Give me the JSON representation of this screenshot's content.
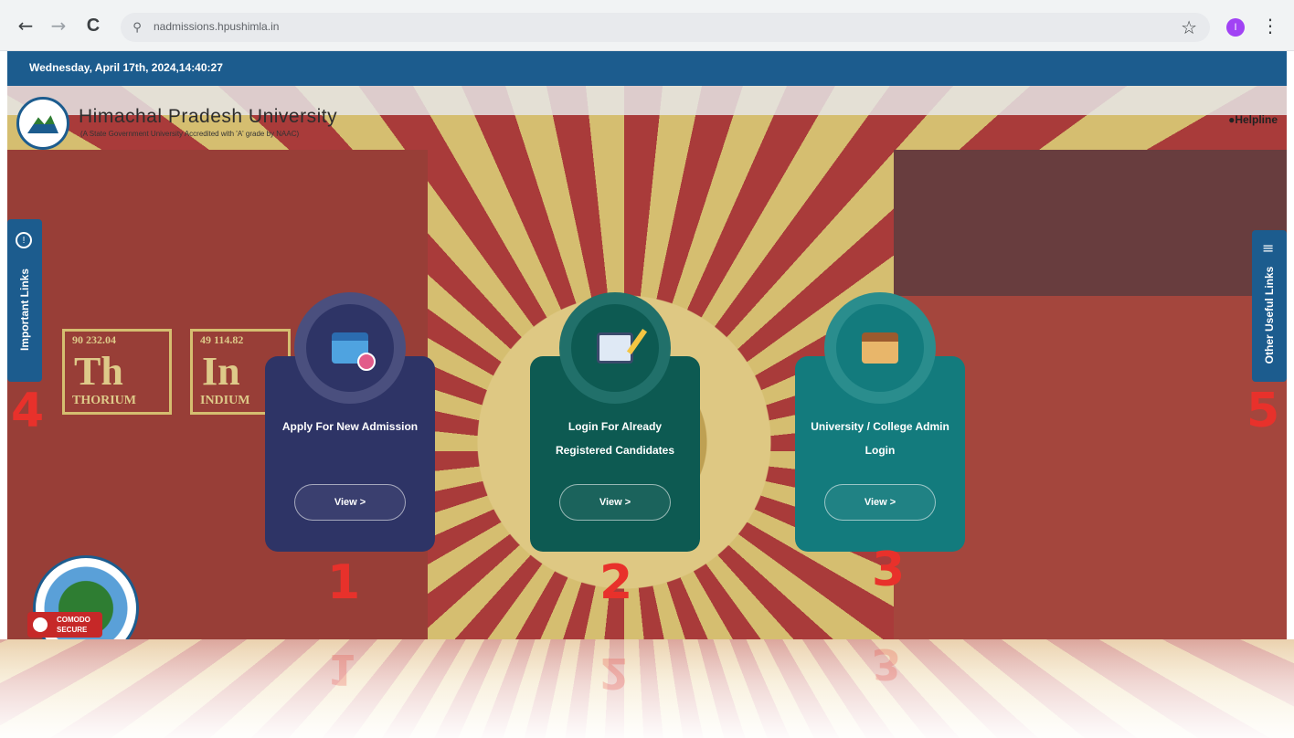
{
  "browser": {
    "back_icon": "←",
    "forward_icon": "→",
    "reload_icon": "C",
    "site_info_icon": "⚲",
    "url": "nadmissions.hpushimla.in",
    "star_icon": "☆",
    "profile_initial": "I",
    "menu_icon": "⋮"
  },
  "header": {
    "datetime": "Wednesday, April 17th, 2024,14:40:27",
    "university_name": "Himachal Pradesh University",
    "university_subtitle": "(A State Government University Accredited with 'A' grade by NAAC)",
    "helpline": "Helpline"
  },
  "side_tabs": {
    "left": {
      "label": "Important Links",
      "icon": "info-icon",
      "glyph": "!"
    },
    "right": {
      "label": "Other Useful Links",
      "icon": "menu-lines-icon",
      "glyph": "≡"
    }
  },
  "cards": [
    {
      "title": "Apply For New Admission",
      "button": "View >",
      "icon": "calendar-icon",
      "color": "#2e3466"
    },
    {
      "title": "Login For Already Registered Candidates",
      "button": "View >",
      "icon": "form-icon",
      "color": "#0d5a52"
    },
    {
      "title": "University / College Admin Login",
      "button": "View >",
      "icon": "building-icon",
      "color": "#137b7d"
    }
  ],
  "annotations": [
    "1",
    "2",
    "3",
    "4",
    "5"
  ],
  "security_badge": {
    "line1": "COMODO",
    "line2": "SECURE"
  },
  "background_text": {
    "el1": {
      "number": "90 232.04",
      "symbol": "Th",
      "name": "THORIUM"
    },
    "el2": {
      "number": "49 114.82",
      "symbol": "In",
      "name": "INDIUM"
    }
  }
}
